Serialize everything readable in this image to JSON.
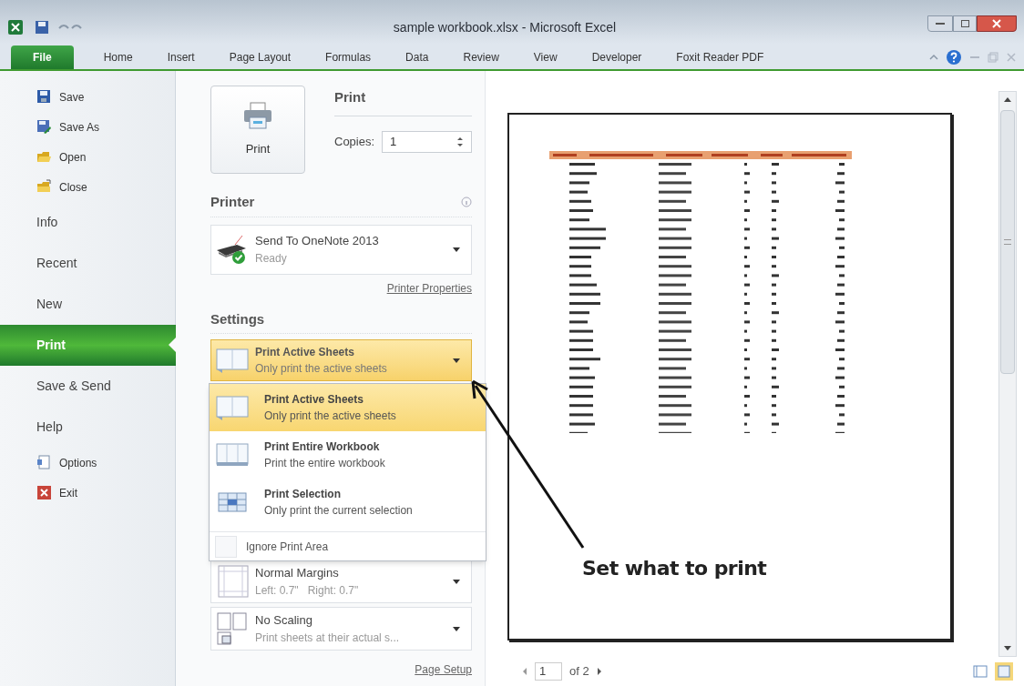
{
  "window": {
    "title": "sample workbook.xlsx - Microsoft Excel"
  },
  "ribbon_tabs": [
    {
      "label": "File",
      "selected": true
    },
    {
      "label": "Home",
      "selected": false
    },
    {
      "label": "Insert",
      "selected": false
    },
    {
      "label": "Page Layout",
      "selected": false
    },
    {
      "label": "Formulas",
      "selected": false
    },
    {
      "label": "Data",
      "selected": false
    },
    {
      "label": "Review",
      "selected": false
    },
    {
      "label": "View",
      "selected": false
    },
    {
      "label": "Developer",
      "selected": false
    },
    {
      "label": "Foxit Reader PDF",
      "selected": false
    }
  ],
  "nav": {
    "items": [
      {
        "label": "Save",
        "kind": "command",
        "selected": false
      },
      {
        "label": "Save As",
        "kind": "command",
        "selected": false
      },
      {
        "label": "Open",
        "kind": "command",
        "selected": false
      },
      {
        "label": "Close",
        "kind": "command",
        "selected": false
      },
      {
        "label": "Info",
        "kind": "section",
        "selected": false
      },
      {
        "label": "Recent",
        "kind": "section",
        "selected": false
      },
      {
        "label": "New",
        "kind": "section",
        "selected": false
      },
      {
        "label": "Print",
        "kind": "section",
        "selected": true
      },
      {
        "label": "Save & Send",
        "kind": "section",
        "selected": false
      },
      {
        "label": "Help",
        "kind": "section",
        "selected": false
      },
      {
        "label": "Options",
        "kind": "command",
        "selected": false
      },
      {
        "label": "Exit",
        "kind": "command",
        "selected": false
      }
    ]
  },
  "print": {
    "heading": "Print",
    "button": "Print",
    "copies_label": "Copies:",
    "copies_value": "1"
  },
  "printer": {
    "heading": "Printer",
    "name": "Send To OneNote 2013",
    "status": "Ready",
    "properties_link": "Printer Properties"
  },
  "settings": {
    "heading": "Settings",
    "what_to_print": {
      "title": "Print Active Sheets",
      "description": "Only print the active sheets",
      "expanded": true
    },
    "menu_items": [
      {
        "title": "Print Active Sheets",
        "description": "Only print the active sheets",
        "selected": true
      },
      {
        "title": "Print Entire Workbook",
        "description": "Print the entire workbook",
        "selected": false
      },
      {
        "title": "Print Selection",
        "description": "Only print the current selection",
        "selected": false
      }
    ],
    "ignore_print_area": {
      "label": "Ignore Print Area",
      "checked": false
    },
    "dropdowns": [
      {
        "kind": "margins",
        "title": "Normal Margins",
        "description": "Left: 0.7\"   Right: 0.7\""
      },
      {
        "kind": "scaling",
        "title": "No Scaling",
        "description": "Print sheets at their actual s..."
      }
    ],
    "page_setup_link": "Page Setup"
  },
  "preview": {
    "page_number": "1",
    "page_count": "of 2"
  },
  "callout": {
    "text": "Set what to print"
  }
}
